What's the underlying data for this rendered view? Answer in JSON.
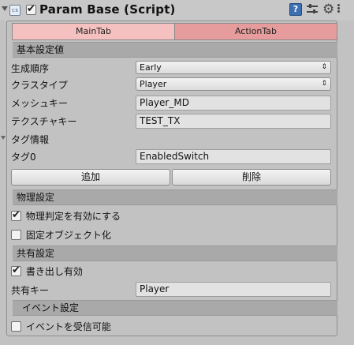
{
  "header": {
    "title": "Param Base (Script)",
    "script_icon_text": "cs",
    "enabled": true,
    "book_icon_text": "?"
  },
  "tabs": [
    {
      "label": "MainTab",
      "active": true
    },
    {
      "label": "ActionTab",
      "active": false
    }
  ],
  "sections": {
    "basic": "基本設定値",
    "physics": "物理設定",
    "shared": "共有設定",
    "events": "イベント設定"
  },
  "fields": {
    "spawn_order": {
      "label": "生成順序",
      "value": "Early"
    },
    "class_type": {
      "label": "クラスタイプ",
      "value": "Player"
    },
    "mesh_key": {
      "label": "メッシュキー",
      "value": "Player_MD"
    },
    "texture_key": {
      "label": "テクスチャキー",
      "value": "TEST_TX"
    },
    "tag_info": {
      "label": "タグ情報"
    },
    "tag0": {
      "label": "タグ0",
      "value": "EnabledSwitch"
    },
    "shared_key": {
      "label": "共有キー",
      "value": "Player"
    }
  },
  "buttons": {
    "add": "追加",
    "remove": "削除"
  },
  "checkboxes": {
    "physics_enabled": {
      "label": "物理判定を有効にする",
      "checked": true
    },
    "fixed_object": {
      "label": "固定オブジェクト化",
      "checked": false
    },
    "write_enabled": {
      "label": "書き出し有効",
      "checked": true
    },
    "event_receive": {
      "label": "イベントを受信可能",
      "checked": false
    }
  },
  "colors": {
    "tab_active": "#f5c0c0",
    "tab_inactive": "#e69c9c",
    "section_bg": "#a9a9a9",
    "panel_bg": "#c2c2c2"
  }
}
